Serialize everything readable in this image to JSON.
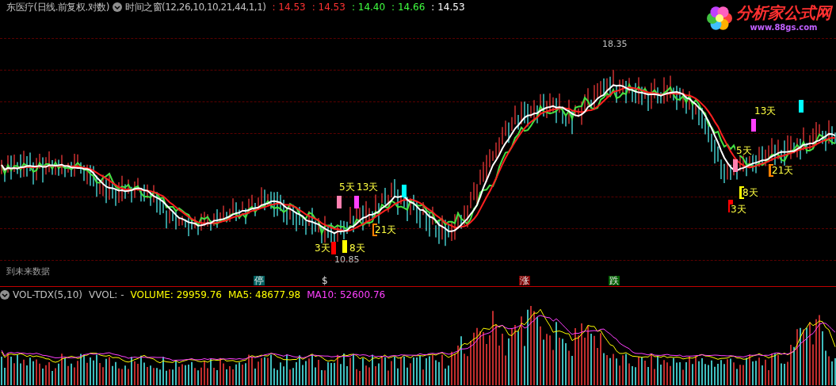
{
  "header": {
    "title": "东医疗(日线.前复权.对数)",
    "indicator": "时间之窗(12,26,10,10,21,44,1,1)",
    "values": [
      {
        "text": ": 14.53",
        "color": "#ff3232"
      },
      {
        "text": ": 14.53",
        "color": "#ff3232"
      },
      {
        "text": ": 14.40",
        "color": "#40ff40"
      },
      {
        "text": ": 14.66",
        "color": "#40ff40"
      },
      {
        "text": ": 14.53",
        "color": "#ffffff"
      }
    ]
  },
  "logo": {
    "name": "分析家公式网",
    "url": "www.88gs.com"
  },
  "price_labels": [
    {
      "text": "18.35"
    },
    {
      "text": "10.85"
    }
  ],
  "markers": [
    {
      "label": "5天",
      "color": "#ff80b0"
    },
    {
      "label": "13天",
      "color": "#ff40ff"
    },
    {
      "color": "#00ffff"
    },
    {
      "label": "21天",
      "color": "#ff8000"
    },
    {
      "label": "3天",
      "color": "#ff0000"
    },
    {
      "label": "8天",
      "color": "#ffff00"
    },
    {
      "label": "13天",
      "color": "#ff40ff"
    },
    {
      "color": "#00ffff"
    },
    {
      "label": "5天",
      "color": "#ff80b0"
    },
    {
      "label": "8天",
      "color": "#ffff00"
    },
    {
      "label": "21天",
      "color": "#ff8000"
    },
    {
      "label": "3天",
      "color": "#ff0000"
    }
  ],
  "note": "到未来数据",
  "events": [
    {
      "label": "停",
      "color": "#006060"
    },
    {
      "label": "$",
      "color": "#000000"
    },
    {
      "label": "涨",
      "color": "#800000"
    },
    {
      "label": "跌",
      "color": "#006000"
    }
  ],
  "volume_header": {
    "name": "VOL-TDX(5,10)",
    "vvol": "VVOL: -",
    "values": [
      {
        "text": "VOLUME: 29959.76",
        "color": "#ffff00"
      },
      {
        "text": "MA5: 48677.98",
        "color": "#ffff00"
      },
      {
        "text": "MA10: 52600.76",
        "color": "#ff40ff"
      }
    ]
  }
}
